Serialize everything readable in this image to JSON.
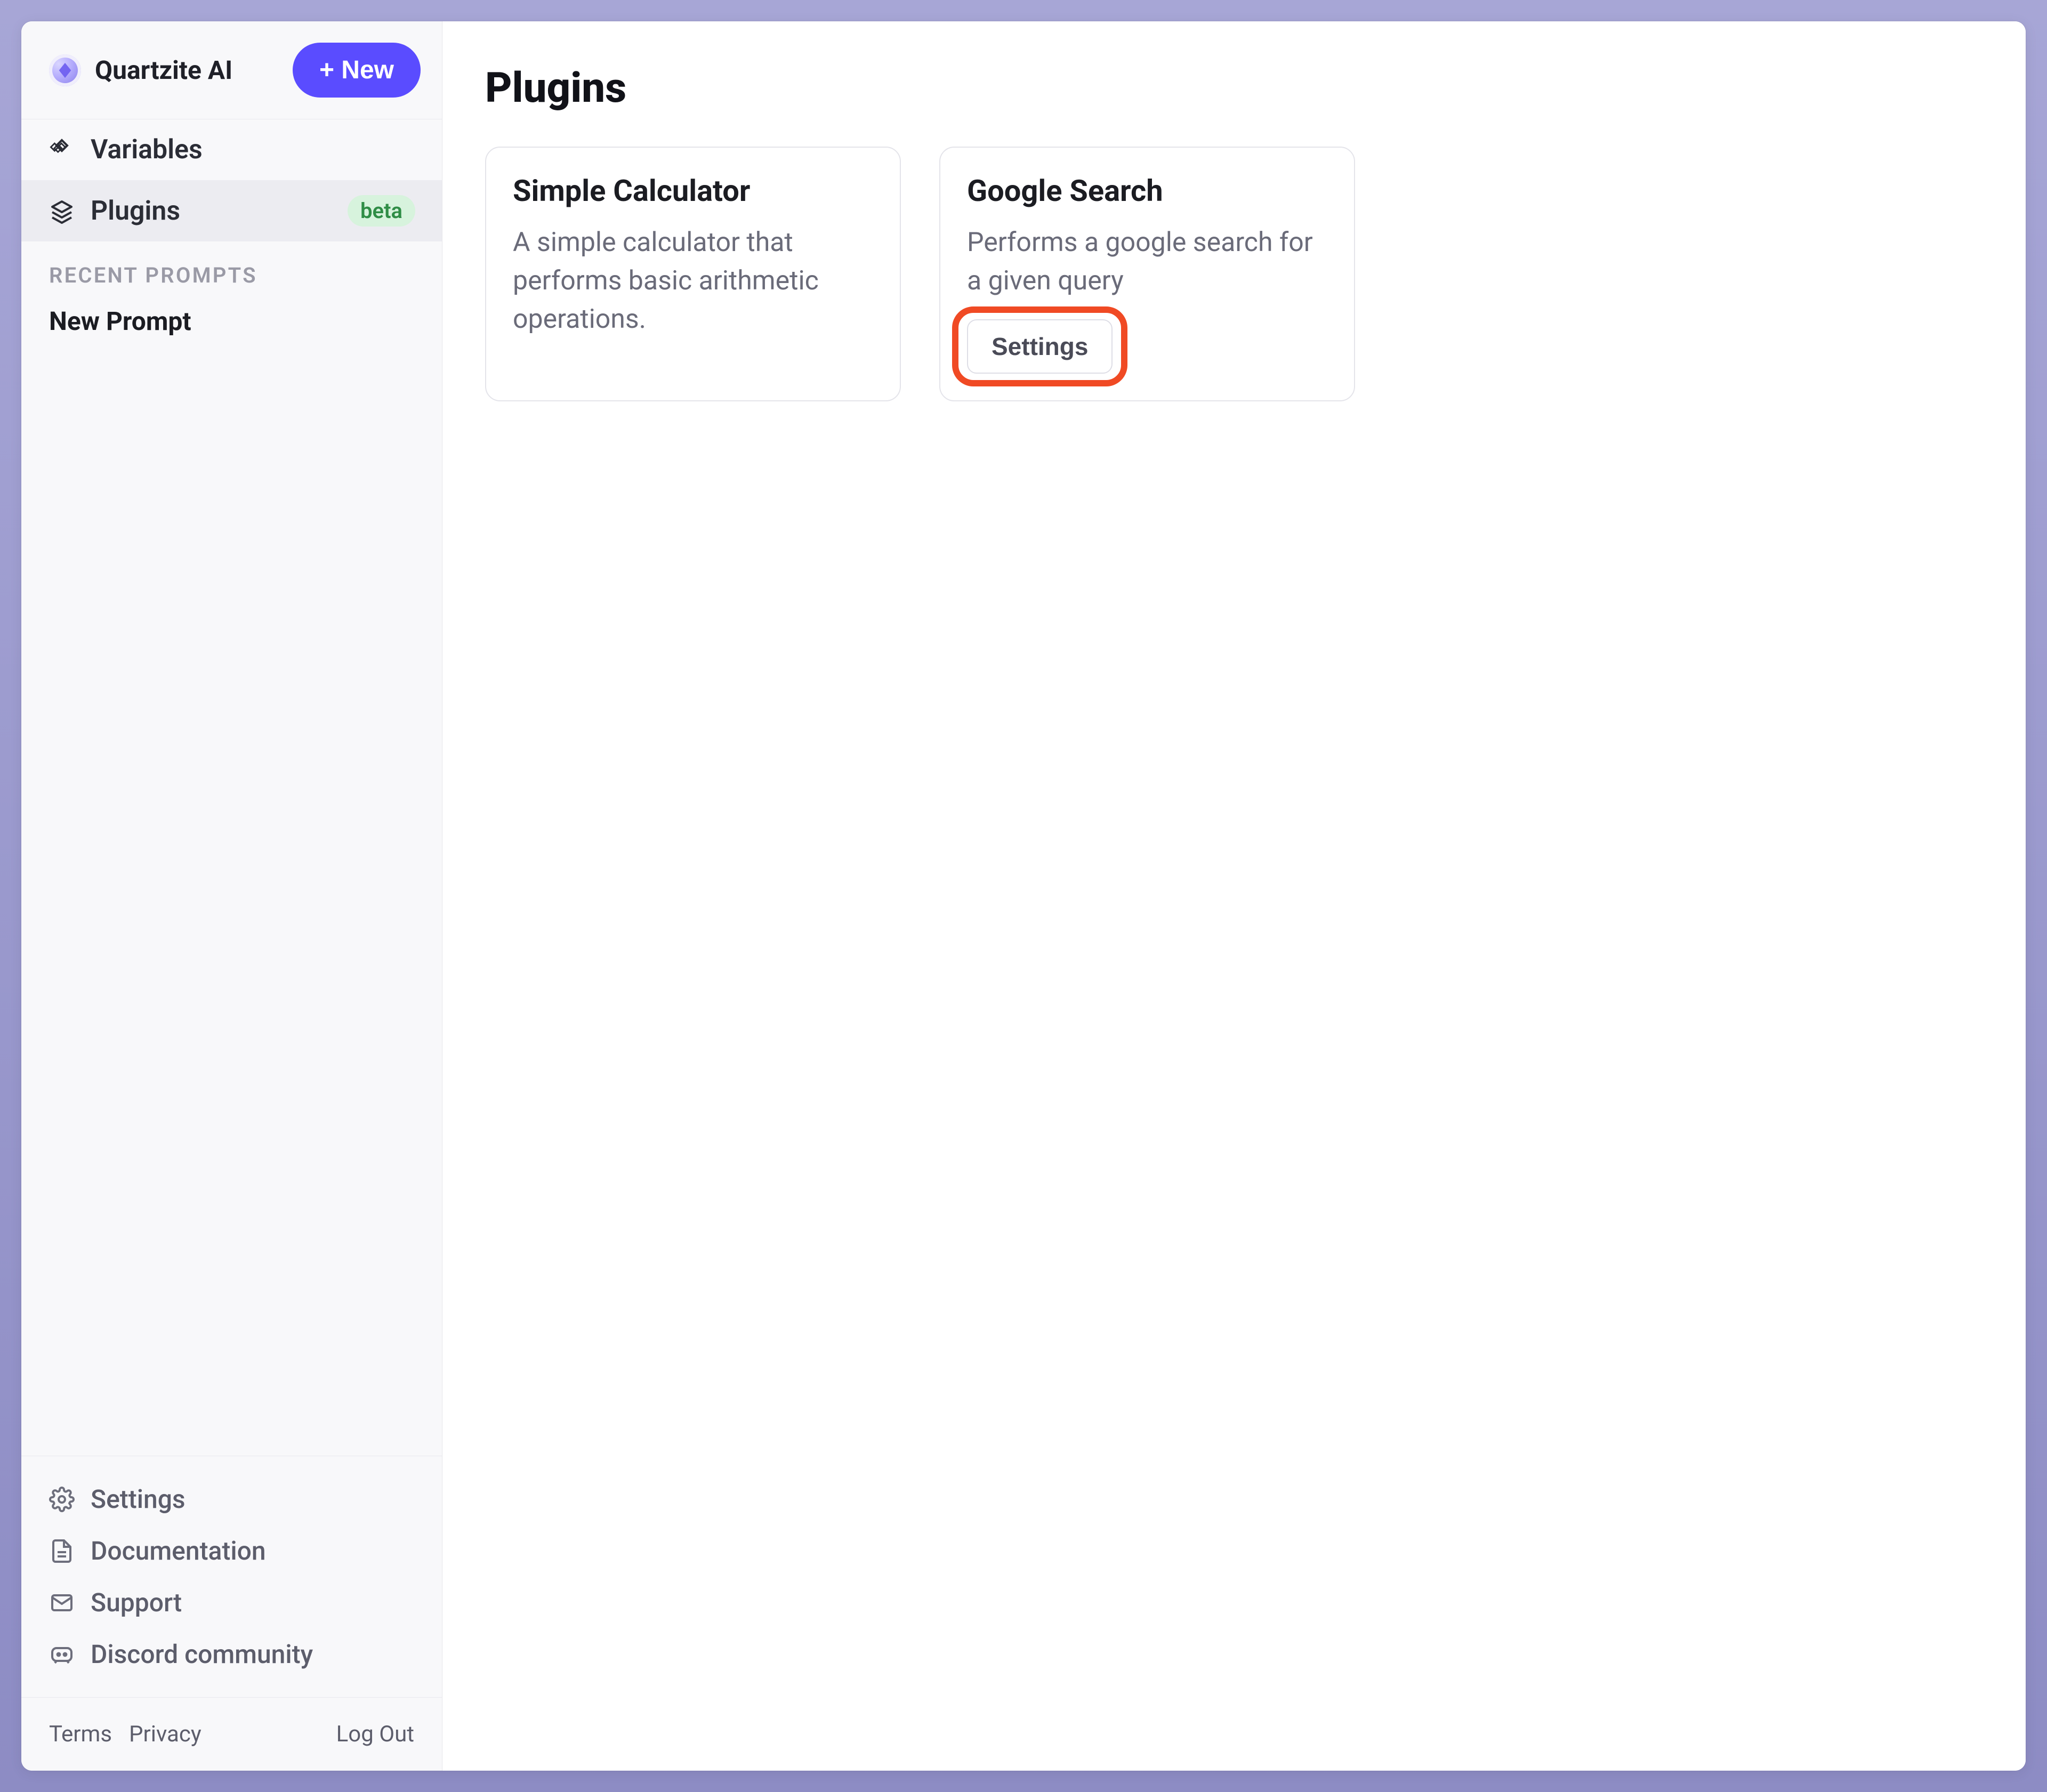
{
  "brand": {
    "name": "Quartzite AI"
  },
  "header": {
    "new_button": "+ New"
  },
  "sidebar": {
    "nav": [
      {
        "label": "Variables",
        "badge": null,
        "active": false,
        "icon": "grid"
      },
      {
        "label": "Plugins",
        "badge": "beta",
        "active": true,
        "icon": "layers"
      }
    ],
    "recent_heading": "RECENT PROMPTS",
    "recent_items": [
      {
        "label": "New Prompt"
      }
    ],
    "bottom_items": [
      {
        "label": "Settings",
        "icon": "gear"
      },
      {
        "label": "Documentation",
        "icon": "doc"
      },
      {
        "label": "Support",
        "icon": "mail"
      },
      {
        "label": "Discord community",
        "icon": "discord"
      }
    ],
    "footer": {
      "terms": "Terms",
      "privacy": "Privacy",
      "logout": "Log Out"
    }
  },
  "main": {
    "title": "Plugins",
    "plugins": [
      {
        "title": "Simple Calculator",
        "description": "A simple calculator that performs basic arithmetic operations.",
        "settings_label": null,
        "highlight_settings": false
      },
      {
        "title": "Google Search",
        "description": "Performs a google search for a given query",
        "settings_label": "Settings",
        "highlight_settings": true
      }
    ]
  }
}
